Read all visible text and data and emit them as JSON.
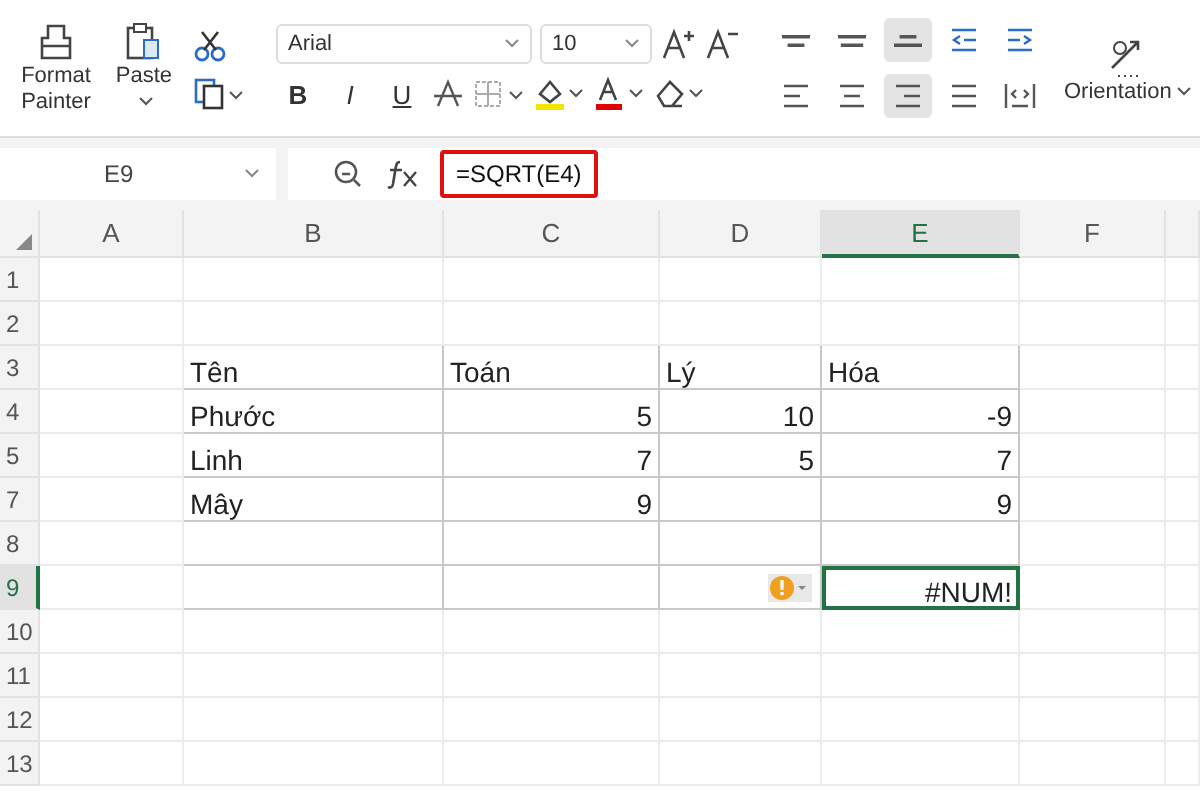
{
  "ribbon": {
    "clipboard": [
      {
        "kind": "format-painter",
        "label": "Format Painter"
      },
      {
        "kind": "paste",
        "label": "Paste"
      }
    ],
    "font": {
      "name": "Arial",
      "size": "10"
    },
    "styles": [
      {
        "kind": "bold",
        "label": "B"
      },
      {
        "kind": "italic",
        "label": "I"
      },
      {
        "kind": "underline",
        "label": "U"
      }
    ],
    "align_top": [
      {
        "kind": "top",
        "selected": false
      },
      {
        "kind": "middle",
        "selected": false
      },
      {
        "kind": "bottom",
        "selected": true
      },
      {
        "kind": "outdent",
        "selected": false
      },
      {
        "kind": "indent",
        "selected": false
      }
    ],
    "align_bottom": [
      {
        "kind": "left",
        "selected": false
      },
      {
        "kind": "center",
        "selected": false
      },
      {
        "kind": "right",
        "selected": true
      },
      {
        "kind": "justify",
        "selected": false
      },
      {
        "kind": "distributed",
        "selected": false
      }
    ],
    "orientation": "Orientation"
  },
  "formula_bar": {
    "cell_ref": "E9",
    "formula": "=SQRT(E4)",
    "highlighted": true
  },
  "columns": [
    {
      "label": "A",
      "selected": false
    },
    {
      "label": "B",
      "selected": false
    },
    {
      "label": "C",
      "selected": false
    },
    {
      "label": "D",
      "selected": false
    },
    {
      "label": "E",
      "selected": true
    },
    {
      "label": "F",
      "selected": false
    }
  ],
  "rows": [
    {
      "label": "1",
      "selected": false,
      "cells": [
        {
          "kind": "empty"
        },
        {
          "kind": "empty"
        },
        {
          "kind": "empty"
        },
        {
          "kind": "empty"
        },
        {
          "kind": "empty"
        },
        {
          "kind": "empty"
        }
      ]
    },
    {
      "label": "2",
      "selected": false,
      "cells": [
        {
          "kind": "empty"
        },
        {
          "kind": "empty"
        },
        {
          "kind": "empty"
        },
        {
          "kind": "empty"
        },
        {
          "kind": "empty"
        },
        {
          "kind": "empty"
        }
      ]
    },
    {
      "label": "3",
      "selected": false,
      "cells": [
        {
          "kind": "empty"
        },
        {
          "kind": "text",
          "text": "Tên"
        },
        {
          "kind": "text",
          "text": "Toán"
        },
        {
          "kind": "text",
          "text": "Lý"
        },
        {
          "kind": "text",
          "text": "Hóa"
        },
        {
          "kind": "empty"
        }
      ]
    },
    {
      "label": "4",
      "selected": false,
      "cells": [
        {
          "kind": "empty"
        },
        {
          "kind": "text",
          "text": "Phước"
        },
        {
          "kind": "number",
          "text": "5"
        },
        {
          "kind": "number",
          "text": "10"
        },
        {
          "kind": "number",
          "text": "-9"
        },
        {
          "kind": "empty"
        }
      ]
    },
    {
      "label": "5",
      "selected": false,
      "cells": [
        {
          "kind": "empty"
        },
        {
          "kind": "text",
          "text": "Linh"
        },
        {
          "kind": "number",
          "text": "7"
        },
        {
          "kind": "number",
          "text": "5"
        },
        {
          "kind": "number",
          "text": "7"
        },
        {
          "kind": "empty"
        }
      ]
    },
    {
      "label": "7",
      "selected": false,
      "cells": [
        {
          "kind": "empty"
        },
        {
          "kind": "text",
          "text": "Mây"
        },
        {
          "kind": "number",
          "text": "9"
        },
        {
          "kind": "blank"
        },
        {
          "kind": "number",
          "text": "9"
        },
        {
          "kind": "empty"
        }
      ]
    },
    {
      "label": "8",
      "selected": false,
      "cells": [
        {
          "kind": "empty"
        },
        {
          "kind": "blank"
        },
        {
          "kind": "blank"
        },
        {
          "kind": "blank"
        },
        {
          "kind": "blank"
        },
        {
          "kind": "empty"
        }
      ]
    },
    {
      "label": "9",
      "selected": true,
      "cells": [
        {
          "kind": "empty"
        },
        {
          "kind": "blank"
        },
        {
          "kind": "blank"
        },
        {
          "kind": "blank"
        },
        {
          "kind": "error",
          "text": "#NUM!",
          "selected": true
        },
        {
          "kind": "empty"
        }
      ]
    },
    {
      "label": "10",
      "selected": false,
      "cells": [
        {
          "kind": "empty"
        },
        {
          "kind": "empty"
        },
        {
          "kind": "empty"
        },
        {
          "kind": "empty"
        },
        {
          "kind": "empty"
        },
        {
          "kind": "empty"
        }
      ]
    },
    {
      "label": "11",
      "selected": false,
      "cells": [
        {
          "kind": "empty"
        },
        {
          "kind": "empty"
        },
        {
          "kind": "empty"
        },
        {
          "kind": "empty"
        },
        {
          "kind": "empty"
        },
        {
          "kind": "empty"
        }
      ]
    },
    {
      "label": "12",
      "selected": false,
      "cells": [
        {
          "kind": "empty"
        },
        {
          "kind": "empty"
        },
        {
          "kind": "empty"
        },
        {
          "kind": "empty"
        },
        {
          "kind": "empty"
        },
        {
          "kind": "empty"
        }
      ]
    },
    {
      "label": "13",
      "selected": false,
      "cells": [
        {
          "kind": "empty"
        },
        {
          "kind": "empty"
        },
        {
          "kind": "empty"
        },
        {
          "kind": "empty"
        },
        {
          "kind": "empty"
        },
        {
          "kind": "empty"
        }
      ]
    }
  ]
}
